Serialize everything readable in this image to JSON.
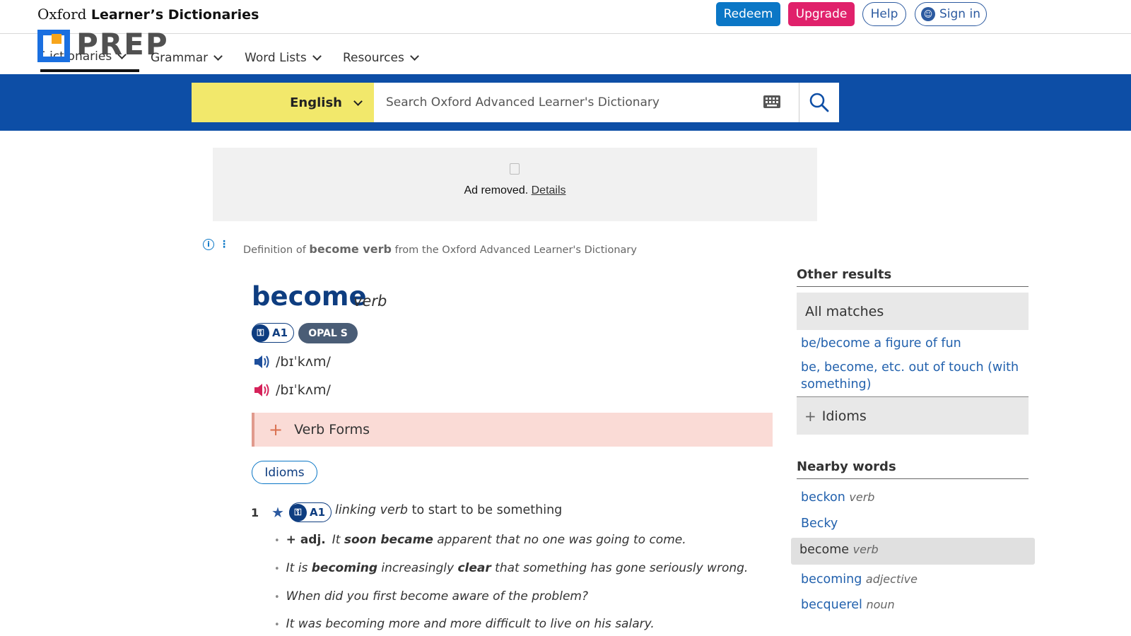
{
  "header": {
    "brand_light": "Oxford",
    "brand_bold": "Learner’s Dictionaries",
    "redeem": "Redeem",
    "upgrade": "Upgrade",
    "help": "Help",
    "sign_in": "Sign in",
    "watermark": "PREP"
  },
  "nav": {
    "dictionaries": "Dictionaries",
    "grammar": "Grammar",
    "word_lists": "Word Lists",
    "resources": "Resources"
  },
  "search": {
    "language": "English",
    "placeholder": "Search Oxford Advanced Learner's Dictionary"
  },
  "ad": {
    "text": "Ad removed.",
    "details": "Details"
  },
  "source": {
    "prefix": "Definition of",
    "word": "become verb",
    "suffix": "from the Oxford Advanced Learner's Dictionary"
  },
  "entry": {
    "headword": "become",
    "pos": "verb",
    "level": "A1",
    "opal": "OPAL S",
    "pron_uk": "/bɪˈkʌm/",
    "pron_us": "/bɪˈkʌm/",
    "verb_forms": "Verb Forms",
    "idioms_button": "Idioms",
    "sense": {
      "number": "1",
      "level": "A1",
      "grammar": "linking verb",
      "definition": "to start to be something"
    },
    "examples": [
      {
        "gram": "+ adj.",
        "pre": "It ",
        "bold": "soon became",
        "post": " apparent that no one was going to come."
      },
      {
        "gram": "",
        "pre": "It is ",
        "bold": "becoming",
        "mid": " increasingly ",
        "bold2": "clear",
        "post": " that something has gone seriously wrong."
      },
      {
        "gram": "",
        "pre": "When did you first become aware of the problem?",
        "bold": "",
        "post": ""
      },
      {
        "gram": "",
        "pre": "It was becoming more and more difficult to live on his salary.",
        "bold": "",
        "post": ""
      }
    ]
  },
  "sidebar": {
    "other_results": "Other results",
    "all_matches": "All matches",
    "matches": [
      "be/become a figure of fun",
      "be, become, etc. out of touch (with something)"
    ],
    "idioms": "Idioms",
    "nearby_words": "Nearby words",
    "nearby": [
      {
        "word": "beckon",
        "pos": "verb"
      },
      {
        "word": "Becky",
        "pos": ""
      },
      {
        "word": "become",
        "pos": "verb"
      },
      {
        "word": "becoming",
        "pos": "adjective"
      },
      {
        "word": "becquerel",
        "pos": "noun"
      }
    ]
  },
  "colors": {
    "search_band": "#0d4ea6",
    "language_select": "#f2e86b",
    "upgrade": "#e0216b",
    "redeem": "#0b77c6",
    "headword": "#0e3d80",
    "verb_forms_bg": "#fadbd6"
  }
}
